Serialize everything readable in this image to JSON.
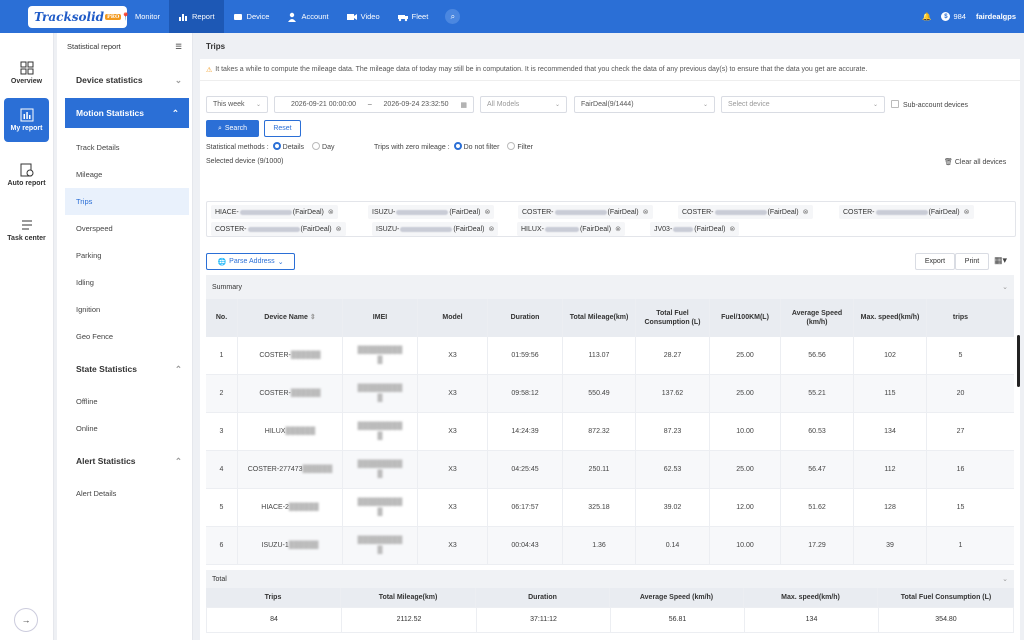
{
  "topnav": {
    "logo": "Tracksolid",
    "logo_badge": "PRO",
    "items": [
      {
        "label": "Monitor",
        "icon": "location-pin-icon"
      },
      {
        "label": "Report",
        "icon": "bar-chart-icon"
      },
      {
        "label": "Device",
        "icon": "device-icon"
      },
      {
        "label": "Account",
        "icon": "user-icon"
      },
      {
        "label": "Video",
        "icon": "video-icon"
      },
      {
        "label": "Fleet",
        "icon": "truck-icon"
      }
    ],
    "coins": "984",
    "user": "fairdealgps"
  },
  "rail": {
    "items": [
      {
        "label": "Overview"
      },
      {
        "label": "My report"
      },
      {
        "label": "Auto report"
      },
      {
        "label": "Task center"
      }
    ],
    "collapse": "→"
  },
  "menu": {
    "header": "Statistical report",
    "sections": {
      "device": "Device statistics",
      "motion": "Motion Statistics",
      "state": "State Statistics",
      "alert": "Alert Statistics"
    },
    "motion_items": [
      "Track Details",
      "Mileage",
      "Trips",
      "Overspeed",
      "Parking",
      "Idling",
      "Ignition",
      "Geo Fence"
    ],
    "state_items": [
      "Offline",
      "Online"
    ],
    "alert_items": [
      "Alert Details"
    ]
  },
  "page": {
    "title": "Trips",
    "notice": "It takes a while to compute the mileage data. The mileage data of today may still be in computation. It is recommended that you check the data of any previous day(s) to ensure that the data you get are accurate."
  },
  "filters": {
    "period": "This week",
    "start": "2026-09-21 00:00:00",
    "dash": "–",
    "end": "2026-09-24 23:32:50",
    "model": "All Models",
    "account": "FairDeal(9/1444)",
    "device_placeholder": "Select device",
    "subaccount": "Sub-account devices",
    "search": "Search",
    "reset": "Reset",
    "stat_label": "Statistical methods :",
    "details": "Details",
    "day": "Day",
    "zero_label": "Trips with zero mileage :",
    "no_filter": "Do not filter",
    "filter": "Filter",
    "selected": "Selected device (9/1000)",
    "clear": "Clear all devices",
    "parse": "Parse Address",
    "export": "Export",
    "print": "Print"
  },
  "devices": [
    {
      "pre": "HIACE-",
      "suf": "(FairDeal)"
    },
    {
      "pre": "ISUZU-",
      "suf": "(FairDeal)"
    },
    {
      "pre": "COSTER-",
      "suf": "(FairDeal)"
    },
    {
      "pre": "COSTER-",
      "suf": "(FairDeal)"
    },
    {
      "pre": "COSTER-",
      "suf": "(FairDeal)"
    },
    {
      "pre": "COSTER-",
      "suf": "(FairDeal)"
    },
    {
      "pre": "ISUZU-",
      "suf": "(FairDeal)"
    },
    {
      "pre": "HILUX-",
      "suf": "(FairDeal)"
    },
    {
      "pre": "JV03-",
      "suf": "(FairDeal)"
    }
  ],
  "summary": {
    "title": "Summary",
    "headers": [
      "No.",
      "Device Name",
      "IMEI",
      "Model",
      "Duration",
      "Total Mileage(km)",
      "Total Fuel Consumption (L)",
      "Fuel/100KM(L)",
      "Average Speed (km/h)",
      "Max. speed(km/h)",
      "trips"
    ],
    "rows": [
      [
        "1",
        "COSTER-",
        "",
        "X3",
        "01:59:56",
        "113.07",
        "28.27",
        "25.00",
        "56.56",
        "102",
        "5"
      ],
      [
        "2",
        "COSTER-",
        "",
        "X3",
        "09:58:12",
        "550.49",
        "137.62",
        "25.00",
        "55.21",
        "115",
        "20"
      ],
      [
        "3",
        "HILUX",
        "",
        "X3",
        "14:24:39",
        "872.32",
        "87.23",
        "10.00",
        "60.53",
        "134",
        "27"
      ],
      [
        "4",
        "COSTER-277473",
        "",
        "X3",
        "04:25:45",
        "250.11",
        "62.53",
        "25.00",
        "56.47",
        "112",
        "16"
      ],
      [
        "5",
        "HIACE-2",
        "",
        "X3",
        "06:17:57",
        "325.18",
        "39.02",
        "12.00",
        "51.62",
        "128",
        "15"
      ],
      [
        "6",
        "ISUZU-1",
        "",
        "X3",
        "00:04:43",
        "1.36",
        "0.14",
        "10.00",
        "17.29",
        "39",
        "1"
      ]
    ]
  },
  "total": {
    "title": "Total",
    "headers": [
      "Trips",
      "Total Mileage(km)",
      "Duration",
      "Average Speed (km/h)",
      "Max. speed(km/h)",
      "Total Fuel Consumption (L)"
    ],
    "values": [
      "84",
      "2112.52",
      "37:11:12",
      "56.81",
      "134",
      "354.80"
    ]
  }
}
